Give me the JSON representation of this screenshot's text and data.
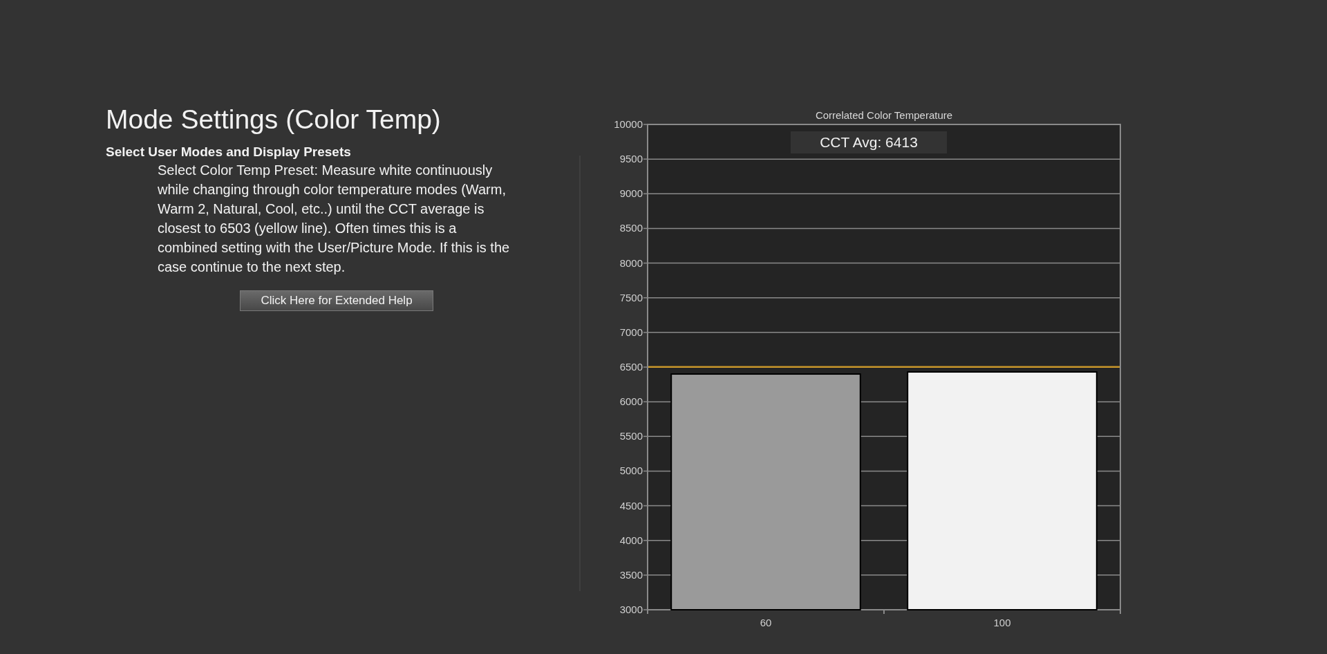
{
  "heading": "Mode Settings (Color Temp)",
  "section_title": "Select User Modes and Display Presets",
  "instructions": "Select Color Temp Preset: Measure white continuously while changing through color temperature modes (Warm, Warm 2, Natural, Cool, etc..) until the CCT average is closest to 6503 (yellow line). Often times this is a combined setting with the User/Picture Mode. If this is the case continue to the next step.",
  "help_button": "Click Here for Extended Help",
  "chart": {
    "chart_data": {
      "type": "bar",
      "title": "Correlated Color Temperature",
      "categories": [
        "60",
        "100"
      ],
      "series": [
        {
          "color": "#9a9a9a",
          "values": [
            6400,
            null
          ]
        },
        {
          "color": "#f2f2f2",
          "values": [
            null,
            6430
          ]
        }
      ],
      "ylim": [
        3000,
        10000
      ],
      "yticks": [
        3000,
        3500,
        4000,
        4500,
        5000,
        5500,
        6000,
        6500,
        7000,
        7500,
        8000,
        8500,
        9000,
        9500,
        10000
      ],
      "grid": true,
      "ref_lines": [
        {
          "axis": "y",
          "value": 6503,
          "color": "#c8962a"
        }
      ],
      "annotations": [
        {
          "text": "CCT Avg: 6413"
        }
      ]
    }
  }
}
